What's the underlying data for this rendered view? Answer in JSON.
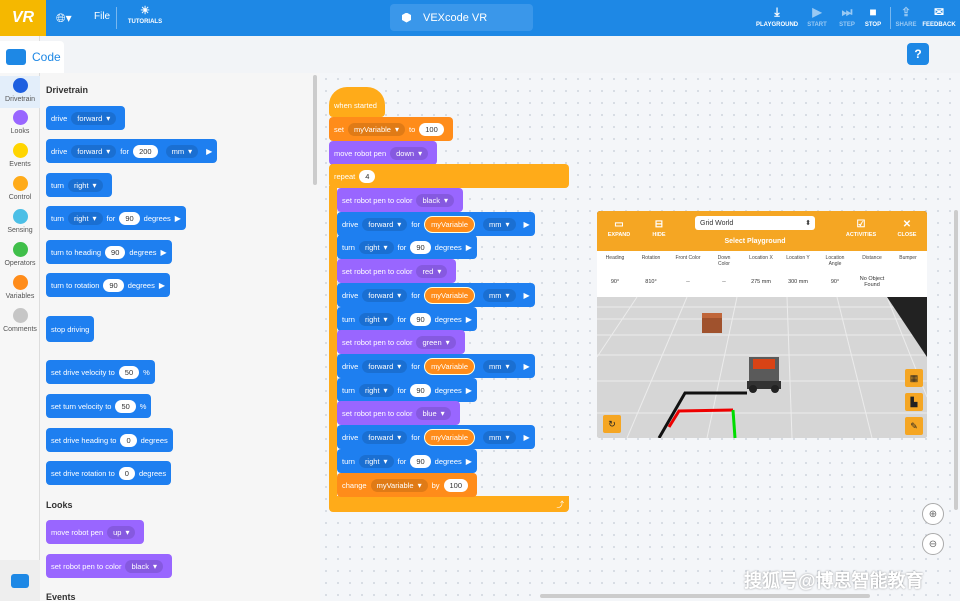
{
  "topbar": {
    "logo": "VR",
    "globe_icon": "globe-icon",
    "file": "File",
    "tutorials": "TUTORIALS",
    "project": "VEXcode VR",
    "playground": "PLAYGROUND",
    "start": "START",
    "step": "STEP",
    "stop": "STOP",
    "share": "SHARE",
    "feedback": "FEEDBACK"
  },
  "code_tab": "Code",
  "categories": [
    {
      "label": "Drivetrain",
      "color": "#1e5fe0"
    },
    {
      "label": "Looks",
      "color": "#9966ff"
    },
    {
      "label": "Events",
      "color": "#ffd500"
    },
    {
      "label": "Control",
      "color": "#ffab19"
    },
    {
      "label": "Sensing",
      "color": "#4cbfe6"
    },
    {
      "label": "Operators",
      "color": "#40bf4a"
    },
    {
      "label": "Variables",
      "color": "#ff8c1a"
    },
    {
      "label": "Comments",
      "color": "#c6c6c6"
    }
  ],
  "palette": {
    "drivetrain_title": "Drivetrain",
    "looks_title": "Looks",
    "events_title": "Events",
    "drive": "drive",
    "forward": "forward",
    "for": "for",
    "mm": "mm",
    "turn": "turn",
    "right": "right",
    "degrees": "degrees",
    "turn_to_heading": "turn to heading",
    "turn_to_rotation": "turn to rotation",
    "stop_driving": "stop driving",
    "set_drive_velocity": "set drive velocity to",
    "set_turn_velocity": "set turn velocity to",
    "set_drive_heading": "set drive heading to",
    "set_drive_rotation": "set drive rotation to",
    "percent": "%",
    "move_robot_pen": "move robot pen",
    "up": "up",
    "set_robot_pen_color": "set robot pen to color",
    "black": "black",
    "v200": "200",
    "v90": "90",
    "v50": "50",
    "v0": "0"
  },
  "script": {
    "when_started": "when started",
    "set": "set",
    "myVariable": "myVariable",
    "to": "to",
    "v100": "100",
    "move_robot_pen": "move robot pen",
    "down": "down",
    "repeat": "repeat",
    "v4": "4",
    "set_pen_color": "set robot pen to color",
    "black": "black",
    "red": "red",
    "green": "green",
    "blue": "blue",
    "drive": "drive",
    "forward": "forward",
    "for": "for",
    "mm": "mm",
    "turn": "turn",
    "right": "right",
    "v90": "90",
    "degrees": "degrees",
    "change": "change",
    "by": "by"
  },
  "playground": {
    "expand": "EXPAND",
    "hide": "HIDE",
    "world": "Grid World",
    "select_playground": "Select Playground",
    "activities": "ACTIVITIES",
    "close": "CLOSE",
    "headers": [
      "Heading",
      "Rotation",
      "Front Color",
      "Down Color",
      "Location X",
      "Location Y",
      "Location Angle",
      "Distance",
      "Bumper"
    ],
    "values": [
      "90°",
      "810°",
      "--",
      "--",
      "275 mm",
      "300 mm",
      "90°",
      "No Object Found",
      ""
    ]
  },
  "help": "?",
  "watermark": "搜狐号@博思智能教育"
}
